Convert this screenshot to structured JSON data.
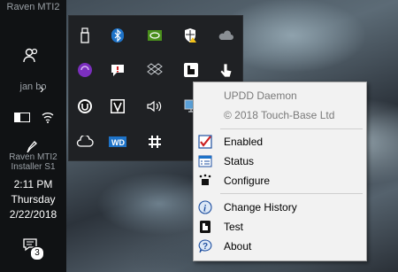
{
  "taskbar": {
    "top_label": "Raven MTI2",
    "user_label": "jan bo",
    "installer_label": "Raven MTI2 Installer S1",
    "clock_time": "2:11 PM",
    "clock_day": "Thursday",
    "clock_date": "2/22/2018",
    "notification_count": "3"
  },
  "tray_icons": [
    "usb-drive-icon",
    "bluetooth-icon",
    "nvidia-icon",
    "windows-defender-icon",
    "onedrive-icon",
    "purple-app-icon",
    "speech-bubble-icon",
    "dropbox-icon",
    "upd-daemon-icon",
    "touch-pointer-icon",
    "headset-u-icon",
    "v-app-icon",
    "volume-icon",
    "network-monitor-icon",
    "creative-cloud-icon",
    "wd-icon",
    "slack-icon"
  ],
  "menu": {
    "header_title": "UPDD Daemon",
    "header_copyright": "© 2018 Touch-Base Ltd",
    "items": [
      {
        "label": "Enabled"
      },
      {
        "label": "Status"
      },
      {
        "label": "Configure"
      },
      {
        "label": "Change History"
      },
      {
        "label": "Test"
      },
      {
        "label": "About"
      }
    ]
  },
  "colors": {
    "accent_blue": "#1e73c8",
    "check_red": "#cc2020",
    "menu_bg": "#f2f2f2",
    "tray_bg": "#1f2124"
  }
}
